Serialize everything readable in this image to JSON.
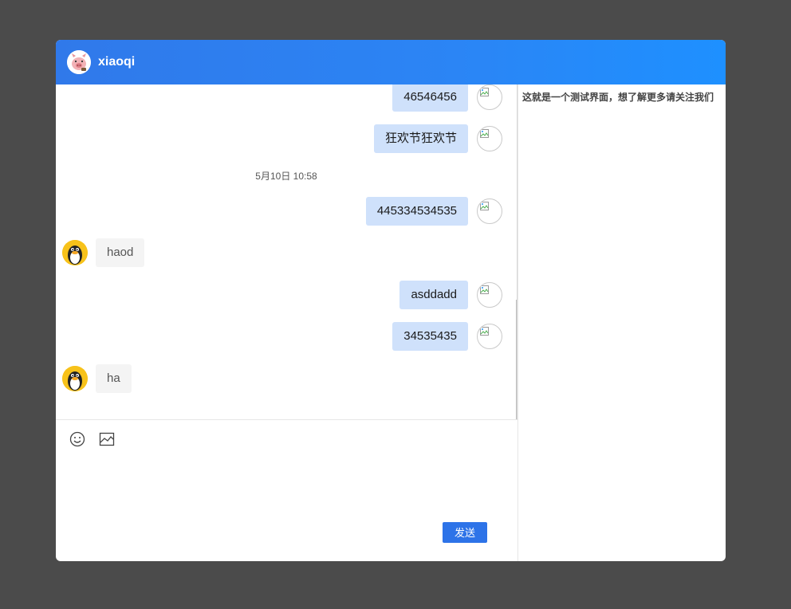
{
  "header": {
    "title": "xiaoqi",
    "avatar_icon": "pig-avatar-icon"
  },
  "messages": [
    {
      "side": "right",
      "text": "46546456"
    },
    {
      "side": "right",
      "text": "狂欢节狂欢节"
    },
    {
      "side": "right",
      "text": "445334534535"
    },
    {
      "side": "left",
      "text": "haod"
    },
    {
      "side": "right",
      "text": "asddadd"
    },
    {
      "side": "right",
      "text": "34535435"
    },
    {
      "side": "left",
      "text": "ha"
    }
  ],
  "timestamp": "5月10日 10:58",
  "toolbar": {
    "emoji_icon": "smiley-icon",
    "image_icon": "image-icon"
  },
  "send_label": "发送",
  "info_panel": {
    "text": "这就是一个测试界面，想了解更多请关注我们"
  },
  "colors": {
    "header_start": "#3079ea",
    "header_end": "#1e90ff",
    "my_bubble": "#cfe1fb",
    "peer_bubble": "#f4f4f4",
    "send_button": "#2d73e8",
    "background": "#4b4b4b"
  }
}
